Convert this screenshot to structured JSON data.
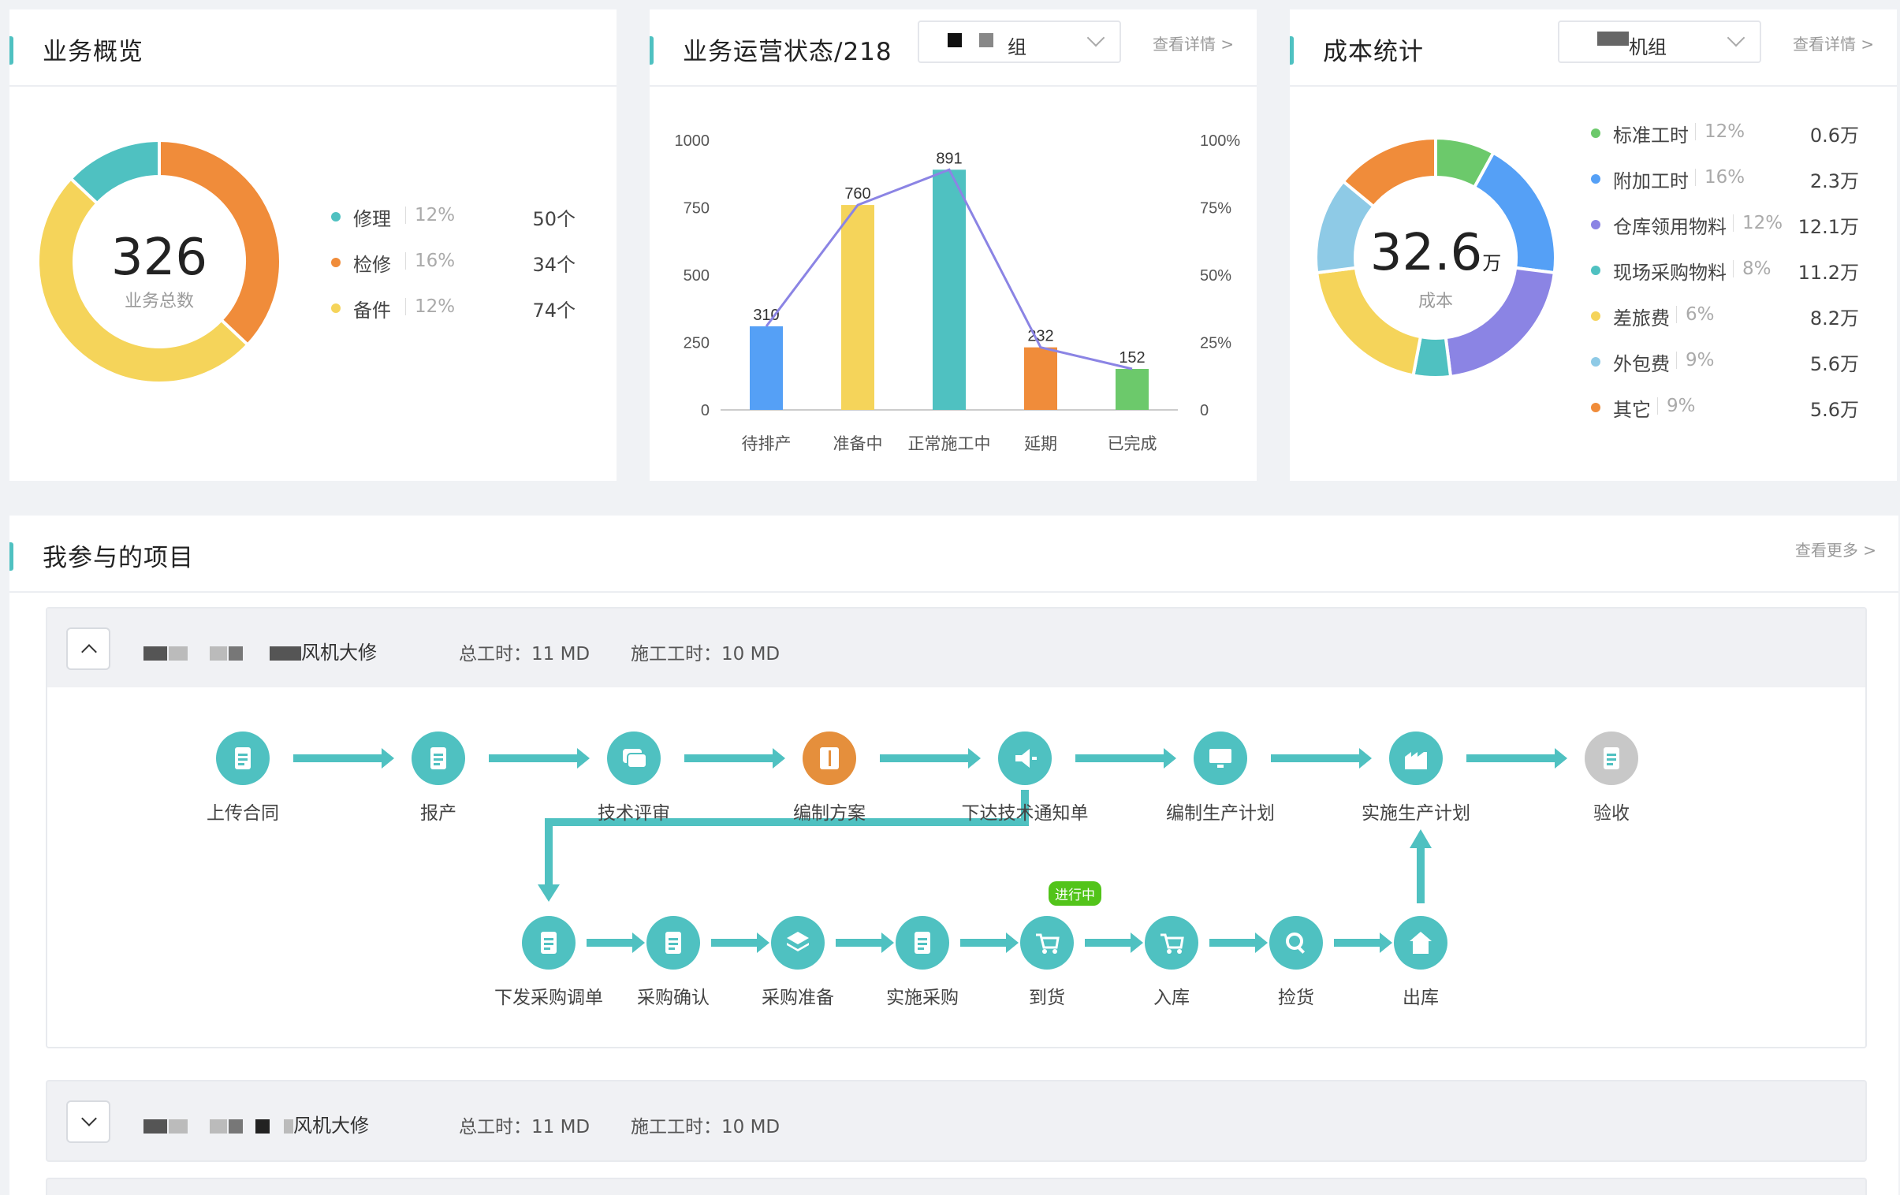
{
  "overview": {
    "title": "业务概览",
    "total": "326",
    "total_label": "业务总数",
    "items": [
      {
        "name": "修理",
        "pct": "12%",
        "count": "50个",
        "color": "#4fc1c1"
      },
      {
        "name": "检修",
        "pct": "16%",
        "count": "34个",
        "color": "#f08c3a"
      },
      {
        "name": "备件",
        "pct": "12%",
        "count": "74个",
        "color": "#f5d45a"
      }
    ]
  },
  "ops": {
    "title": "业务运营状态/218",
    "select_value": "组",
    "detail_link": "查看详情 >"
  },
  "cost": {
    "title": "成本统计",
    "select_value": "机组",
    "detail_link": "查看详情 >",
    "total": "32.6",
    "unit": "万",
    "total_label": "成本",
    "items": [
      {
        "name": "标准工时",
        "pct": "12%",
        "amount": "0.6万",
        "color": "#6cc96b"
      },
      {
        "name": "附加工时",
        "pct": "16%",
        "amount": "2.3万",
        "color": "#55a0f6"
      },
      {
        "name": "仓库领用物料",
        "pct": "12%",
        "amount": "12.1万",
        "color": "#8b84e4"
      },
      {
        "name": "现场采购物料",
        "pct": "8%",
        "amount": "11.2万",
        "color": "#4fc1c1"
      },
      {
        "name": "差旅费",
        "pct": "6%",
        "amount": "8.2万",
        "color": "#f5d45a"
      },
      {
        "name": "外包费",
        "pct": "9%",
        "amount": "5.6万",
        "color": "#8ecae6"
      },
      {
        "name": "其它",
        "pct": "9%",
        "amount": "5.6万",
        "color": "#f08c3a"
      }
    ]
  },
  "chart_data": {
    "type": "bar",
    "categories": [
      "待排产",
      "准备中",
      "正常施工中",
      "延期",
      "已完成"
    ],
    "values": [
      310,
      760,
      891,
      232,
      152
    ],
    "colors": [
      "#55a0f6",
      "#f5d45a",
      "#4fc1c1",
      "#f08c3a",
      "#6cc96b"
    ],
    "line_values": [
      310,
      760,
      891,
      232,
      152
    ],
    "line_color": "#8b84e4",
    "ylim": [
      0,
      1000
    ],
    "yticks": [
      "1000",
      "750",
      "500",
      "250",
      "0"
    ],
    "y2ticks": [
      "100%",
      "75%",
      "50%",
      "25%",
      "0"
    ]
  },
  "projects": {
    "title": "我参与的项目",
    "more_link": "查看更多 >",
    "list": [
      {
        "name": "风机大修",
        "total_hours": "总工时：11 MD",
        "work_hours": "施工工时：10 MD"
      },
      {
        "name": "风机大修",
        "total_hours": "总工时：11 MD",
        "work_hours": "施工工时：10 MD"
      }
    ],
    "flow_row1": [
      "上传合同",
      "报产",
      "技术评审",
      "编制方案",
      "下达技术通知单",
      "编制生产计划",
      "实施生产计划",
      "验收"
    ],
    "flow_row2": [
      "下发采购调单",
      "采购确认",
      "采购准备",
      "实施采购",
      "到货",
      "入库",
      "捡货",
      "出库"
    ],
    "status_badge": "进行中"
  }
}
